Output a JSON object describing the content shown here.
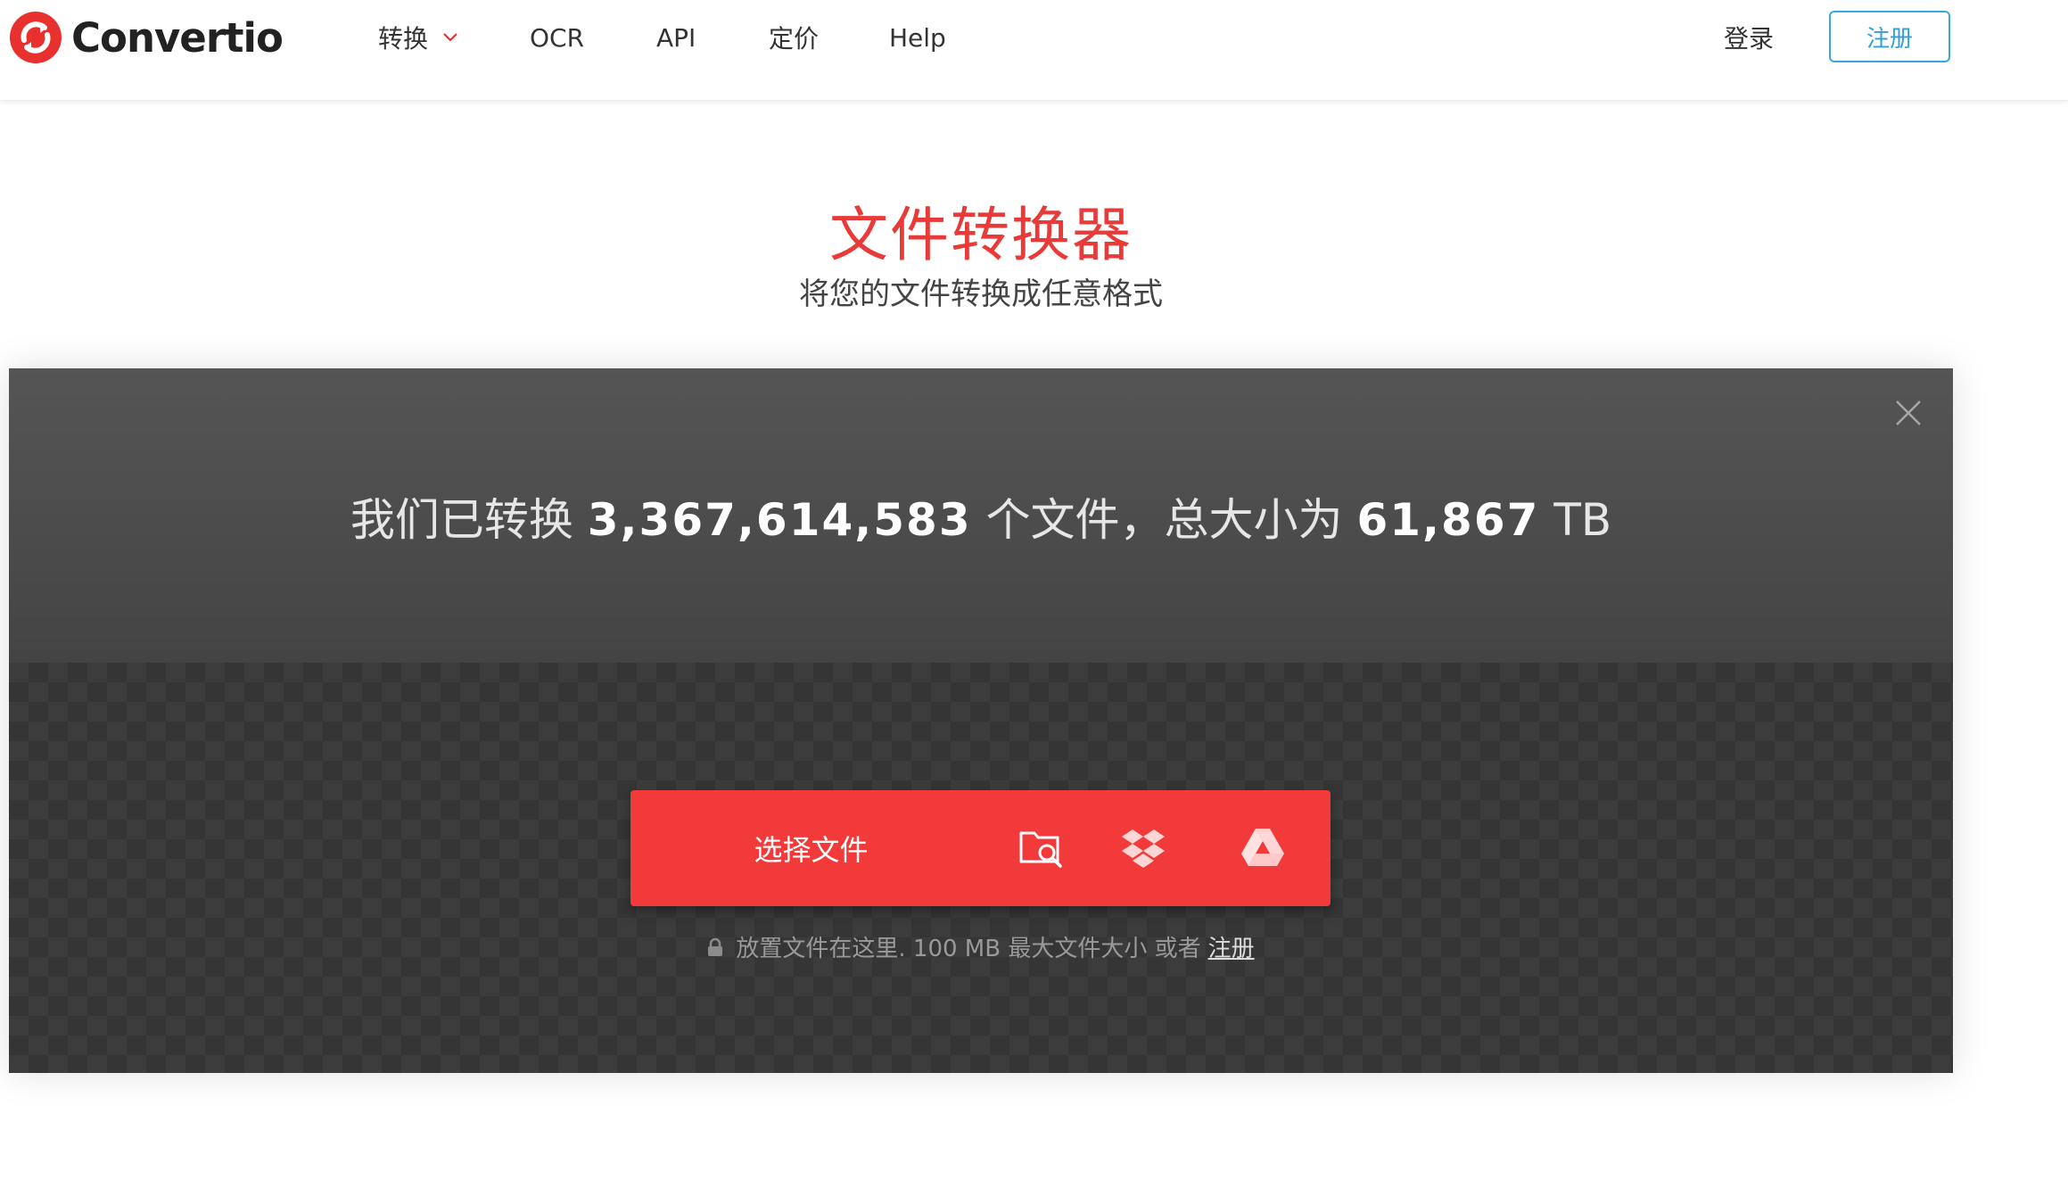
{
  "header": {
    "logo_text": "Convertio",
    "nav": [
      {
        "label": "转换",
        "has_dropdown": true
      },
      {
        "label": "OCR"
      },
      {
        "label": "API"
      },
      {
        "label": "定价"
      },
      {
        "label": "Help"
      }
    ],
    "login_label": "登录",
    "signup_label": "注册"
  },
  "hero": {
    "title": "文件转换器",
    "subtitle": "将您的文件转换成任意格式"
  },
  "stats": {
    "prefix": "我们已转换",
    "files_count": "3,367,614,583",
    "middle": "个文件，总大小为",
    "total_size": "61,867",
    "unit": "TB"
  },
  "upload": {
    "choose_label": "选择文件",
    "sources": [
      {
        "name": "folder-search-icon"
      },
      {
        "name": "dropbox-icon"
      },
      {
        "name": "google-drive-icon"
      }
    ],
    "hint_text": "放置文件在这里. 100 MB 最大文件大小 或者",
    "hint_link": "注册"
  },
  "colors": {
    "brand_red": "#f33a3a",
    "title_red": "#e83a38",
    "signup_blue": "#38a9e0",
    "panel_dark": "#3c3c3c"
  }
}
